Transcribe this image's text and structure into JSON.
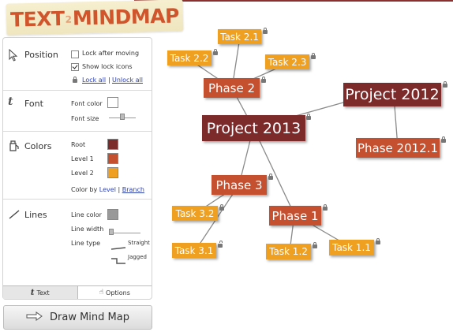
{
  "logo": {
    "part1": "TEXT",
    "part2": "2",
    "part3": "MINDMAP"
  },
  "panel": {
    "position": {
      "title": "Position",
      "lock_after_moving": "Lock after moving",
      "lock_after_moving_checked": false,
      "show_lock_icons": "Show lock icons",
      "show_lock_icons_checked": true,
      "lock_all": "Lock all",
      "separator": "|",
      "unlock_all": "Unlock all"
    },
    "font": {
      "title": "Font",
      "font_color_label": "Font color",
      "font_size_label": "Font size"
    },
    "colors": {
      "title": "Colors",
      "root_label": "Root",
      "level1_label": "Level 1",
      "level2_label": "Level 2",
      "root_color": "#7d2a2b",
      "level1_color": "#c5502f",
      "level2_color": "#f0a020",
      "color_by_prefix": "Color by",
      "color_by_level": "Level",
      "separator": "|",
      "color_by_branch": "Branch"
    },
    "lines": {
      "title": "Lines",
      "line_color_label": "Line color",
      "line_width_label": "Line width",
      "line_type_label": "Line type",
      "straight_label": "Straight",
      "jagged_label": "Jagged"
    },
    "tabs": {
      "text": "Text",
      "options": "Options"
    }
  },
  "draw_button": "Draw Mind Map",
  "mindmap": {
    "project2013": "Project 2013",
    "project2012": "Project 2012",
    "phase2": "Phase 2",
    "phase3": "Phase 3",
    "phase1": "Phase 1",
    "phase2012_1": "Phase 2012.1",
    "task21": "Task 2.1",
    "task22": "Task 2.2",
    "task23": "Task 2.3",
    "task32": "Task 3.2",
    "task31": "Task 3.1",
    "task12": "Task 1.2",
    "task11": "Task 1.1"
  }
}
